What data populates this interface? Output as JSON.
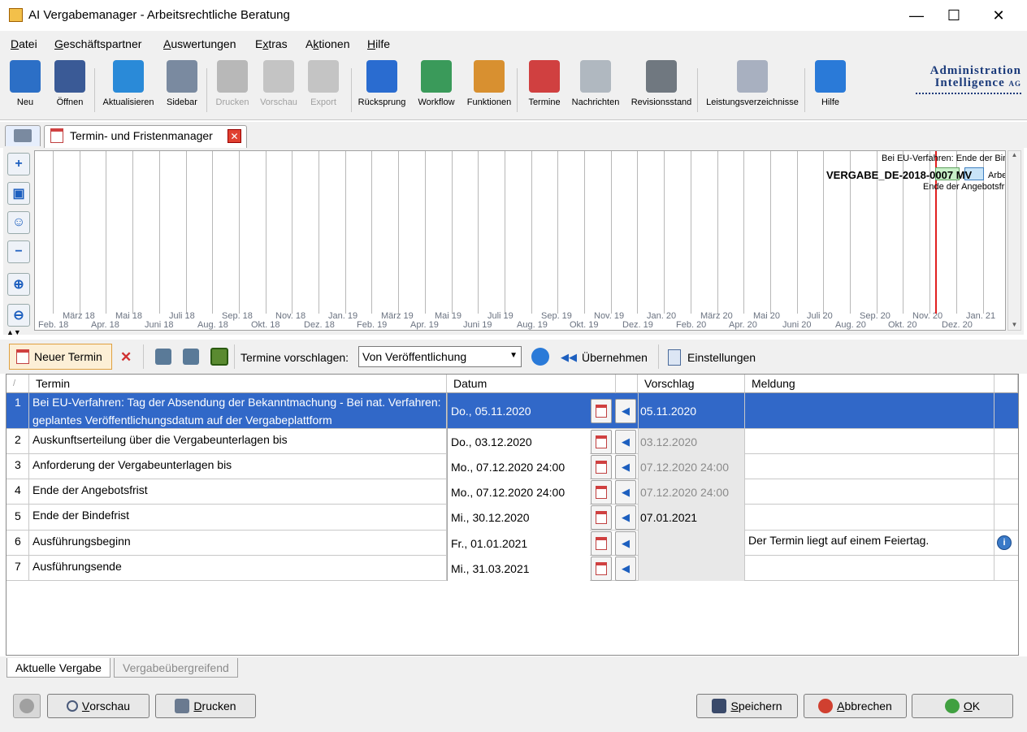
{
  "window": {
    "title": "AI Vergabemanager - Arbeitsrechtliche Beratung",
    "min": "—",
    "max": "☐",
    "close": "✕"
  },
  "menu": [
    {
      "pre": "",
      "u": "D",
      "post": "atei"
    },
    {
      "pre": "",
      "u": "G",
      "post": "eschäftspartner"
    },
    {
      "pre": "",
      "u": "A",
      "post": "uswertungen"
    },
    {
      "pre": "E",
      "u": "x",
      "post": "tras"
    },
    {
      "pre": "A",
      "u": "k",
      "post": "tionen"
    },
    {
      "pre": "",
      "u": "H",
      "post": "ilfe"
    }
  ],
  "toolbar": [
    {
      "label": "Neu",
      "enabled": true,
      "color": "#2c6fc6"
    },
    {
      "label": "Öffnen",
      "enabled": true,
      "color": "#3a5a96"
    },
    {
      "label": "Aktualisieren",
      "enabled": true,
      "color": "#2a8ad8"
    },
    {
      "label": "Sidebar",
      "enabled": true,
      "color": "#7a8aa0"
    },
    {
      "label": "Drucken",
      "enabled": false,
      "color": "#b8b8b8"
    },
    {
      "label": "Vorschau",
      "enabled": false,
      "color": "#c4c4c4"
    },
    {
      "label": "Export",
      "enabled": false,
      "color": "#c4c4c4"
    },
    {
      "label": "Rücksprung",
      "enabled": true,
      "color": "#2a6cd0"
    },
    {
      "label": "Workflow",
      "enabled": true,
      "color": "#3a9a5a"
    },
    {
      "label": "Funktionen",
      "enabled": true,
      "color": "#d89030"
    },
    {
      "label": "Termine",
      "enabled": true,
      "color": "#d04040"
    },
    {
      "label": "Nachrichten",
      "enabled": true,
      "color": "#b0b8c0"
    },
    {
      "label": "Revisionsstand",
      "enabled": true,
      "color": "#707880"
    },
    {
      "label": "Leistungsverzeichnisse",
      "enabled": true,
      "color": "#a8b0c0"
    },
    {
      "label": "Hilfe",
      "enabled": true,
      "color": "#2a7ad8"
    }
  ],
  "logo": {
    "line1": "Administration",
    "line2": "Intelligence",
    "suffix": "AG"
  },
  "doc_tab": {
    "label": "Termin- und Fristenmanager",
    "close": "✕"
  },
  "timeline": {
    "buttons": [
      "plus-icon",
      "folder-add-icon",
      "user-add-icon",
      "minus-icon",
      "zoom-in-icon",
      "zoom-out-icon"
    ],
    "upper_ticks": [
      "März 18",
      "Mai 18",
      "Juli 18",
      "Sep. 18",
      "Nov. 18",
      "Jan. 19",
      "März 19",
      "Mai 19",
      "Juli 19",
      "Sep. 19",
      "Nov. 19",
      "Jan. 20",
      "März 20",
      "Mai 20",
      "Juli 20",
      "Sep. 20",
      "Nov. 20",
      "Jan. 21"
    ],
    "lower_ticks": [
      "Feb. 18",
      "Apr. 18",
      "Juni 18",
      "Aug. 18",
      "Okt. 18",
      "Dez. 18",
      "Feb. 19",
      "Apr. 19",
      "Juni 19",
      "Aug. 19",
      "Okt. 19",
      "Dez. 19",
      "Feb. 20",
      "Apr. 20",
      "Juni 20",
      "Aug. 20",
      "Okt. 20",
      "Dez. 20"
    ],
    "annot1": "Bei EU-Verfahren: Ende der Bindefrist",
    "annot2": "VERGABE_DE-2018-0007 MV",
    "annot2b": "Arbe",
    "annot3": "Ende der Angebotsfrist"
  },
  "editbar": {
    "new_label": "Neuer Termin",
    "delete": "✕",
    "suggest_label": "Termine vorschlagen:",
    "combo_value": "Von Veröffentlichung",
    "apply_label": "Übernehmen",
    "settings_label": "Einstellungen"
  },
  "grid": {
    "headers": {
      "num": "/",
      "term": "Termin",
      "date": "Datum",
      "vorschlag": "Vorschlag",
      "meldung": "Meldung"
    },
    "rows": [
      {
        "num": "1",
        "term": "Bei EU-Verfahren: Tag der Absendung der Bekanntmachung - Bei nat. Verfahren: geplantes Veröffentlichungsdatum auf der Vergabeplattform",
        "date": "Do., 05.11.2020",
        "vorschlag": "05.11.2020",
        "meldung": ""
      },
      {
        "num": "2",
        "term": "Auskunftserteilung über die Vergabeunterlagen bis",
        "date": "Do., 03.12.2020",
        "vorschlag": "03.12.2020",
        "meldung": ""
      },
      {
        "num": "3",
        "term": "Anforderung der Vergabeunterlagen bis",
        "date": "Mo., 07.12.2020 24:00",
        "vorschlag": "07.12.2020 24:00",
        "meldung": ""
      },
      {
        "num": "4",
        "term": "Ende der Angebotsfrist",
        "date": "Mo., 07.12.2020 24:00",
        "vorschlag": "07.12.2020 24:00",
        "meldung": ""
      },
      {
        "num": "5",
        "term": "Ende der Bindefrist",
        "date": "Mi., 30.12.2020",
        "vorschlag": "07.01.2021",
        "meldung": ""
      },
      {
        "num": "6",
        "term": "Ausführungsbeginn",
        "date": "Fr., 01.01.2021",
        "vorschlag": "",
        "meldung": "Der Termin liegt auf einem Feiertag."
      },
      {
        "num": "7",
        "term": "Ausführungsende",
        "date": "Mi., 31.03.2021",
        "vorschlag": "",
        "meldung": ""
      }
    ]
  },
  "bottom_tabs": [
    "Aktuelle Vergabe",
    "Vergabeübergreifend"
  ],
  "footer": {
    "preview": {
      "u": "V",
      "post": "orschau"
    },
    "print": {
      "u": "D",
      "post": "rucken"
    },
    "save": {
      "u": "S",
      "post": "peichern"
    },
    "cancel": {
      "u": "A",
      "post": "bbrechen"
    },
    "ok": {
      "u": "O",
      "post": "K"
    }
  }
}
